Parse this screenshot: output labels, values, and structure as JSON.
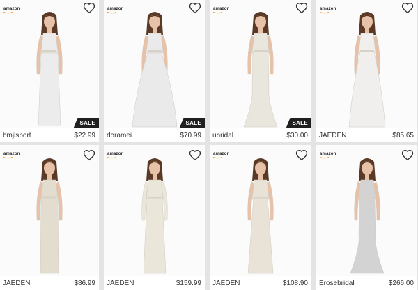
{
  "products": [
    {
      "brand": "bmjlsport",
      "price": "$22.99",
      "badge": "SALE",
      "store_logo": "amazon",
      "icon": "heart-outline-icon",
      "dress_color": "#ececec",
      "dress_shape": "tea"
    },
    {
      "brand": "doramei",
      "price": "$70.99",
      "badge": "SALE",
      "store_logo": "amazon",
      "icon": "heart-outline-icon",
      "dress_color": "#eaeaea",
      "dress_shape": "ball"
    },
    {
      "brand": "ubridal",
      "price": "$30.00",
      "badge": "SALE",
      "store_logo": "amazon",
      "icon": "heart-outline-icon",
      "dress_color": "#e9e6dd",
      "dress_shape": "mermaid"
    },
    {
      "brand": "JAEDEN",
      "price": "$85.65",
      "badge": "",
      "store_logo": "amazon",
      "icon": "heart-outline-icon",
      "dress_color": "#f0efed",
      "dress_shape": "aline"
    },
    {
      "brand": "JAEDEN",
      "price": "$86.99",
      "badge": "",
      "store_logo": "amazon",
      "icon": "heart-outline-icon",
      "dress_color": "#e3ddcf",
      "dress_shape": "column"
    },
    {
      "brand": "JAEDEN",
      "price": "$159.99",
      "badge": "",
      "store_logo": "amazon",
      "icon": "heart-outline-icon",
      "dress_color": "#ebe6da",
      "dress_shape": "sleeve"
    },
    {
      "brand": "JAEDEN",
      "price": "$108.90",
      "badge": "",
      "store_logo": "amazon",
      "icon": "heart-outline-icon",
      "dress_color": "#e8e3d6",
      "dress_shape": "cape"
    },
    {
      "brand": "Erosebridal",
      "price": "$266.00",
      "badge": "",
      "store_logo": "amazon",
      "icon": "heart-outline-icon",
      "dress_color": "#d3d3d3",
      "dress_shape": "mermaid"
    }
  ],
  "colors": {
    "skin": "#e8c2a8",
    "hair": "#5a3a26",
    "sale_badge": "#1f1f1f",
    "amazon_smile": "#f29a1c"
  }
}
